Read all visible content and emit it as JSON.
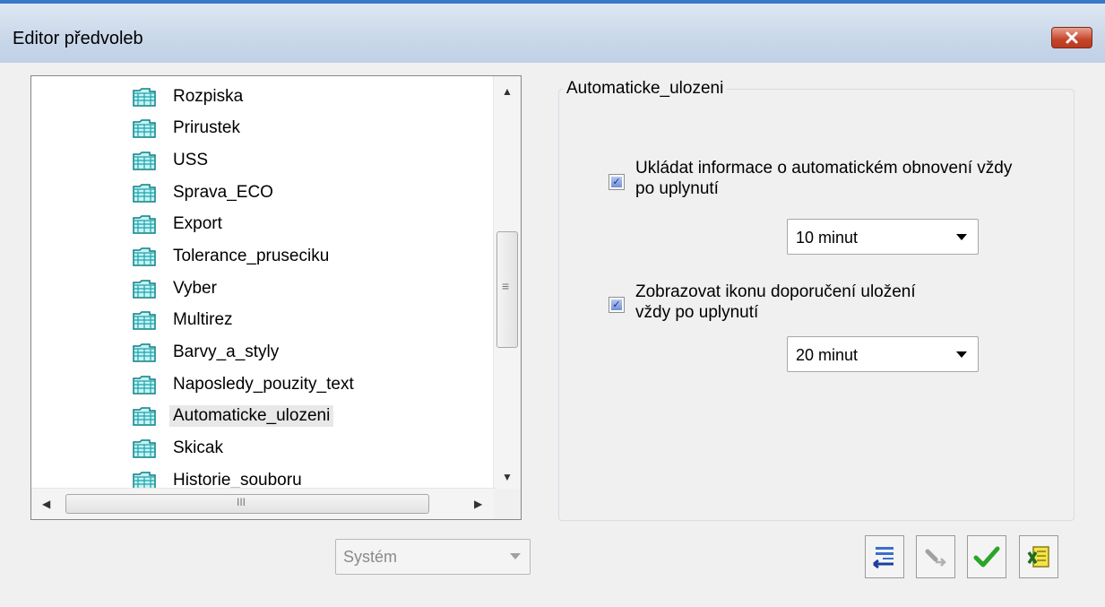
{
  "window": {
    "title": "Editor předvoleb"
  },
  "tree": {
    "items": [
      {
        "label": "Rozpiska"
      },
      {
        "label": "Prirustek"
      },
      {
        "label": "USS"
      },
      {
        "label": "Sprava_ECO"
      },
      {
        "label": "Export"
      },
      {
        "label": "Tolerance_pruseciku"
      },
      {
        "label": "Vyber"
      },
      {
        "label": "Multirez"
      },
      {
        "label": "Barvy_a_styly"
      },
      {
        "label": "Naposledy_pouzity_text"
      },
      {
        "label": "Automaticke_ulozeni"
      },
      {
        "label": "Skicak"
      },
      {
        "label": "Historie_souboru"
      }
    ],
    "selected_index": 10,
    "scroll_glyph": "III",
    "grip_glyph": "≡"
  },
  "system_combo": {
    "value": "Systém"
  },
  "settings": {
    "group_title": "Automaticke_ulozeni",
    "autosave": {
      "label": "Ukládat informace o automatickém obnovení vždy po uplynutí",
      "checked": true,
      "interval": "10 minut"
    },
    "save_reminder": {
      "label": "Zobrazovat ikonu doporučení uložení vždy po uplynutí",
      "checked": true,
      "interval": "20 minut"
    }
  },
  "toolbar": {
    "buttons": [
      {
        "icon": "list-import-icon"
      },
      {
        "icon": "tools-disabled-icon"
      },
      {
        "icon": "checkmark-icon"
      },
      {
        "icon": "excel-export-icon"
      }
    ]
  },
  "colors": {
    "titlebar_accent": "#3a78c8",
    "close_red": "#c7442b",
    "check_green": "#2aa52a",
    "folder_teal": "#1aa3a3"
  }
}
